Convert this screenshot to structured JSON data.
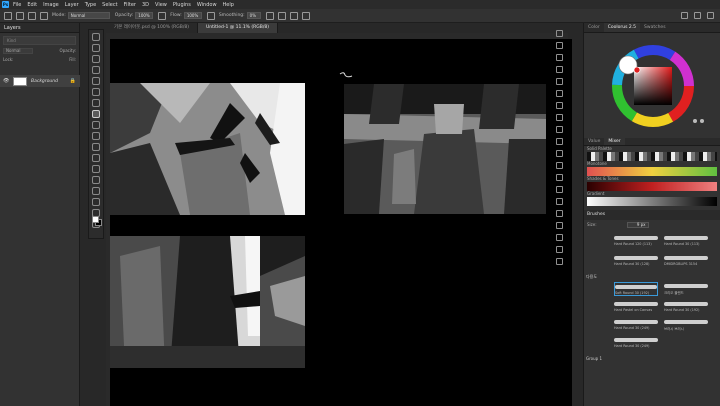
{
  "app": {
    "logo_text": "Ps"
  },
  "menu": [
    "File",
    "Edit",
    "Image",
    "Layer",
    "Type",
    "Select",
    "Filter",
    "3D",
    "View",
    "Plugins",
    "Window",
    "Help"
  ],
  "options_bar": {
    "mode_label": "Mode:",
    "mode_value": "Normal",
    "opacity_label": "Opacity:",
    "opacity_value": "100%",
    "flow_label": "Flow:",
    "flow_value": "100%",
    "smoothing_label": "Smoothing:",
    "smoothing_value": "0%"
  },
  "layers_panel": {
    "tab": "Layers",
    "search_placeholder": "Kind",
    "mode": "Normal",
    "opacity_label": "Opacity:",
    "lock_label": "Lock:",
    "fill_label": "Fill:",
    "layer_name": "Background",
    "eye_glyph": "👁",
    "lock_glyph": "🔒"
  },
  "document_tabs": [
    {
      "label": "기본 레이아웃.psd @ 100% (RGB/8)",
      "active": false
    },
    {
      "label": "Untitled-1 @ 11.1% (RGB/8)",
      "active": true
    }
  ],
  "right_panel": {
    "tabs": [
      "Color",
      "Coolorus 2.5",
      "Swatches"
    ],
    "value_label": "Value",
    "mixer_label": "Mixer",
    "solid_palette_label": "Solid Palette",
    "monotone_label": "Monotone",
    "shades_label": "Shades & Tones",
    "gradient_label": "Gradient",
    "brushes_header": "Brushes",
    "size_label": "Size:",
    "size_value": "9 px",
    "brushes": [
      {
        "name": "Hard Round 120 (113)"
      },
      {
        "name": "Hard Round 30 (113)"
      },
      {
        "name": "Hard Round 30 (128)"
      },
      {
        "name": "DMIDRGBLIPS 3154"
      },
      {
        "name": "Soft Round 30 (192)"
      },
      {
        "name": "크리오 블렌드"
      },
      {
        "name": "Hard Pastel on Canvas"
      },
      {
        "name": "Hard Round 30 (192)"
      },
      {
        "name": "Hard Round 30 (249)"
      },
      {
        "name": "브러시 브러시"
      },
      {
        "name": "Hard Round 30 (249)"
      }
    ],
    "group_1": "다용도",
    "group_2": "Group 1"
  },
  "colors": {
    "accent": "#3a9ad9",
    "canvas": "#000000",
    "panel": "#323232"
  }
}
